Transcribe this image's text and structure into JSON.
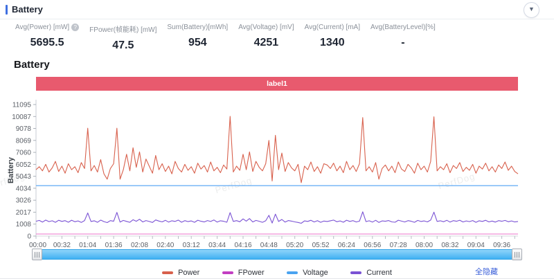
{
  "header": {
    "title": "Battery",
    "collapse_icon": "▼"
  },
  "stats": {
    "columns": [
      {
        "label": "Avg(Power) [mW]",
        "value": "5695.5",
        "has_help_icon": true,
        "help_glyph": "?"
      },
      {
        "label": "FPower(帧能耗) [mW]",
        "value": "47.5"
      },
      {
        "label": "Sum(Battery)[mWh]",
        "value": "954"
      },
      {
        "label": "Avg(Voltage) [mV]",
        "value": "4251"
      },
      {
        "label": "Avg(Current) [mA]",
        "value": "1340"
      },
      {
        "label": "Avg(BatteryLevel)[%]",
        "value": "-"
      }
    ]
  },
  "section_title": "Battery",
  "chart": {
    "banner_label": "label1",
    "y_axis_title": "Battery"
  },
  "colors": {
    "accent_blue": "#3f6fe0",
    "banner_red": "#e85a6e",
    "link_blue": "#3a5fd9",
    "power": "#d8604c",
    "fpower_legend": "#c23ec2",
    "fpower_line": "#ee82d0",
    "voltage_legend": "#4aa3f0",
    "voltage_line": "#6cb0f5",
    "current": "#7a52d4",
    "scrollbar_blue": "#41b0f2"
  },
  "chart_data": {
    "type": "line",
    "title": "Battery",
    "ylabel": "Battery",
    "ylim": [
      0,
      11095
    ],
    "yticks": [
      11095,
      10087,
      9078,
      8069,
      7060,
      6052,
      5043,
      4034,
      3026,
      2017,
      1008,
      0
    ],
    "xticks": [
      "00:00",
      "00:32",
      "01:04",
      "01:36",
      "02:08",
      "02:40",
      "03:12",
      "03:44",
      "04:16",
      "04:48",
      "05:20",
      "05:52",
      "06:24",
      "06:56",
      "07:28",
      "08:00",
      "08:32",
      "09:04",
      "09:36"
    ],
    "x_tick_interval_s": 32,
    "x_minor_tick_s": 16,
    "x_max_s": 596,
    "grid": false,
    "legend_position": "bottom",
    "series": [
      {
        "name": "FPower",
        "color": "#ee82d0",
        "width": 2,
        "opacity": 0.55,
        "values": [
          47.5,
          47.5
        ]
      },
      {
        "name": "Voltage",
        "color": "#6cb0f5",
        "width": 1.4,
        "opacity": 1,
        "values": [
          4251,
          4251
        ]
      },
      {
        "name": "Current",
        "color": "#7a52d4",
        "width": 1.1,
        "opacity": 1,
        "values": [
          1250,
          1320,
          1180,
          1350,
          1220,
          1290,
          1160,
          1330,
          1240,
          1300,
          1170,
          1340,
          1210,
          1280,
          1150,
          1310,
          1950,
          1230,
          1290,
          1160,
          1350,
          1220,
          1140,
          1300,
          1250,
          2000,
          1180,
          1320,
          1240,
          1160,
          1380,
          1250,
          1420,
          1190,
          1310,
          1230,
          1150,
          1360,
          1270,
          1200,
          1330,
          1180,
          1290,
          1240,
          1350,
          1170,
          1300,
          1220,
          1280,
          1160,
          1340,
          1250,
          1190,
          1310,
          1230,
          1360,
          1180,
          1290,
          1250,
          1170,
          1980,
          1240,
          1300,
          1210,
          1450,
          1260,
          1480,
          1190,
          1320,
          1250,
          1160,
          1290,
          1750,
          1100,
          1850,
          1230,
          1400,
          1180,
          1310,
          1260,
          1200,
          1150,
          1080,
          1280,
          1240,
          1330,
          1190,
          1300,
          1160,
          1270,
          1230,
          1290,
          1350,
          1210,
          1280,
          1170,
          1340,
          1240,
          1300,
          1190,
          1260,
          2050,
          1220,
          1290,
          1180,
          1330,
          1150,
          1280,
          1250,
          1310,
          1200,
          1170,
          1340,
          1260,
          1190,
          1300,
          1250,
          1160,
          1320,
          1230,
          1280,
          1200,
          1350,
          2020,
          1240,
          1290,
          1210,
          1330,
          1180,
          1300,
          1250,
          1340,
          1190,
          1280,
          1220,
          1310,
          1160,
          1290,
          1240,
          1330,
          1200,
          1270,
          1180,
          1300,
          1250,
          1320,
          1210,
          1280,
          1190,
          1230
        ]
      },
      {
        "name": "Power",
        "color": "#d8604c",
        "width": 1.1,
        "opacity": 1,
        "values": [
          5600,
          5850,
          5500,
          6050,
          5400,
          5750,
          6300,
          5450,
          5900,
          5300,
          6100,
          5600,
          5850,
          5350,
          6200,
          5700,
          9100,
          5500,
          5950,
          5400,
          6450,
          5250,
          4800,
          5700,
          6100,
          9100,
          4800,
          5600,
          6900,
          5500,
          7450,
          5800,
          7100,
          5400,
          6500,
          5900,
          5300,
          6800,
          5600,
          6100,
          5450,
          5900,
          5250,
          6300,
          5700,
          5400,
          6050,
          5550,
          5850,
          5300,
          6150,
          5650,
          5950,
          5400,
          6250,
          5500,
          5800,
          5350,
          6000,
          5650,
          10100,
          5400,
          5900,
          5550,
          6900,
          5600,
          7100,
          5450,
          6300,
          5800,
          5500,
          6100,
          8070,
          4650,
          8500,
          5600,
          7000,
          5450,
          6200,
          5750,
          5500,
          6050,
          4500,
          5900,
          5600,
          6250,
          5450,
          5850,
          5300,
          6100,
          6000,
          5700,
          6150,
          5500,
          5900,
          5350,
          6300,
          5600,
          5950,
          5450,
          6100,
          10000,
          5500,
          5850,
          5400,
          6200,
          4800,
          5700,
          6000,
          5500,
          5900,
          5350,
          6250,
          5650,
          5450,
          6050,
          5750,
          5300,
          6150,
          5600,
          5900,
          5400,
          6300,
          10060,
          5500,
          5850,
          5600,
          6100,
          5350,
          5950,
          5700,
          6200,
          5450,
          5800,
          5550,
          6050,
          5300,
          5900,
          5650,
          6150,
          5500,
          5850,
          5400,
          6000,
          5700,
          6250,
          5550,
          5900,
          5450,
          5250
        ]
      }
    ]
  },
  "legend": {
    "items": [
      {
        "label": "Power",
        "color": "#d8604c"
      },
      {
        "label": "FPower",
        "color": "#c23ec2"
      },
      {
        "label": "Voltage",
        "color": "#4aa3f0"
      },
      {
        "label": "Current",
        "color": "#7a52d4"
      }
    ]
  },
  "hide_all_label": "全隐藏",
  "watermark": {
    "text": "PerfDog"
  }
}
